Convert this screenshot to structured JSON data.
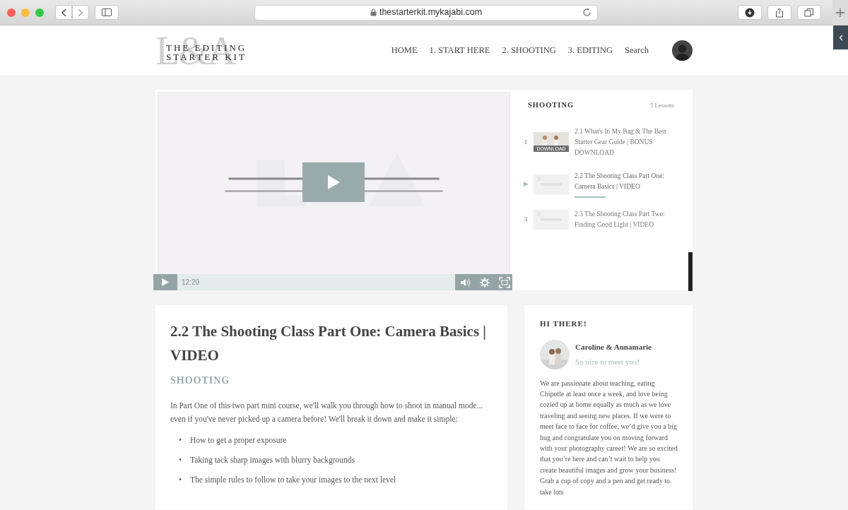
{
  "browser": {
    "url": "thestarterkit.mykajabi.com"
  },
  "site": {
    "logo_mark": "L&A",
    "logo_lines": [
      "THE EDITING",
      "STARTER KIT"
    ],
    "nav": [
      {
        "label": "HOME",
        "selected": false
      },
      {
        "label": "1. START HERE",
        "selected": false
      },
      {
        "label": "2. SHOOTING",
        "selected": false
      },
      {
        "label": "3. EDITING",
        "selected": false
      },
      {
        "label": "Search",
        "selected": false
      }
    ]
  },
  "video": {
    "time": "12:20"
  },
  "lessons": {
    "title": "SHOOTING",
    "count": "5 Lessons",
    "items": [
      {
        "marker": "1",
        "title": "2.1 What's In My Bag & The Best Starter Gear Guide | BONUS DOWNLOAD",
        "thumb_label": "DOWNLOAD",
        "selected": false
      },
      {
        "marker": "▶",
        "title": "2.2 The Shooting Class Part One: Camera Basics | VIDEO",
        "selected": true
      },
      {
        "marker": "3",
        "title": "2.3 The Shooting Class Part Two: Finding Good Light | VIDEO",
        "selected": false
      }
    ]
  },
  "article": {
    "title": "2.2 The Shooting Class Part One: Camera Basics | VIDEO",
    "category": "SHOOTING",
    "intro": "In Part One of this two part mini course, we'll walk you through how to shoot in manual mode... even if you've never picked up a camera before! We'll break it down and make it simple:",
    "bullet_marker": "•",
    "bullets": [
      "How to get a proper exposure",
      "Taking tack sharp images with blurry backgrounds",
      "The simple rules to follow to take your images to the next level"
    ]
  },
  "about": {
    "heading": "HI THERE!",
    "name": "Caroline & Annamarie",
    "tagline": "So nice to meet you!",
    "bio": "We are passionate about teaching, eating Chipotle at least once a week, and love being cozied up at home equally as much as we love traveling and seeing new places. If we were to meet face to face for coffee, we’d give you a big hug and congratulate you on moving forward with your photography career! We are so excited that you’re here and can’t wait to help you create beautiful images and grow your business! Grab a cup of copy and a pen and get ready to take lots"
  }
}
